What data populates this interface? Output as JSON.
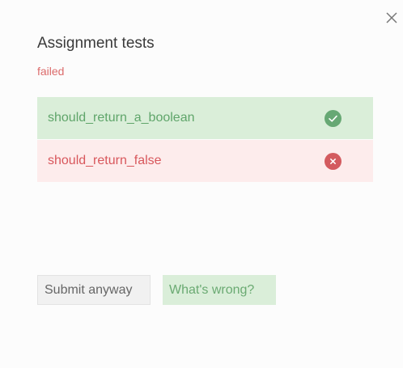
{
  "dialog": {
    "title": "Assignment tests",
    "status": "failed",
    "close_icon": "close-icon"
  },
  "tests": [
    {
      "name": "should_return_a_boolean",
      "result": "passed",
      "icon": "check-circle-icon"
    },
    {
      "name": "should_return_false",
      "result": "failed",
      "icon": "x-circle-icon"
    }
  ],
  "actions": {
    "submit_label": "Submit anyway",
    "help_label": "What's wrong?"
  },
  "colors": {
    "pass_bg": "#daeed9",
    "pass_fg": "#5fa56a",
    "fail_bg": "#fdecec",
    "fail_fg": "#d8575c"
  }
}
